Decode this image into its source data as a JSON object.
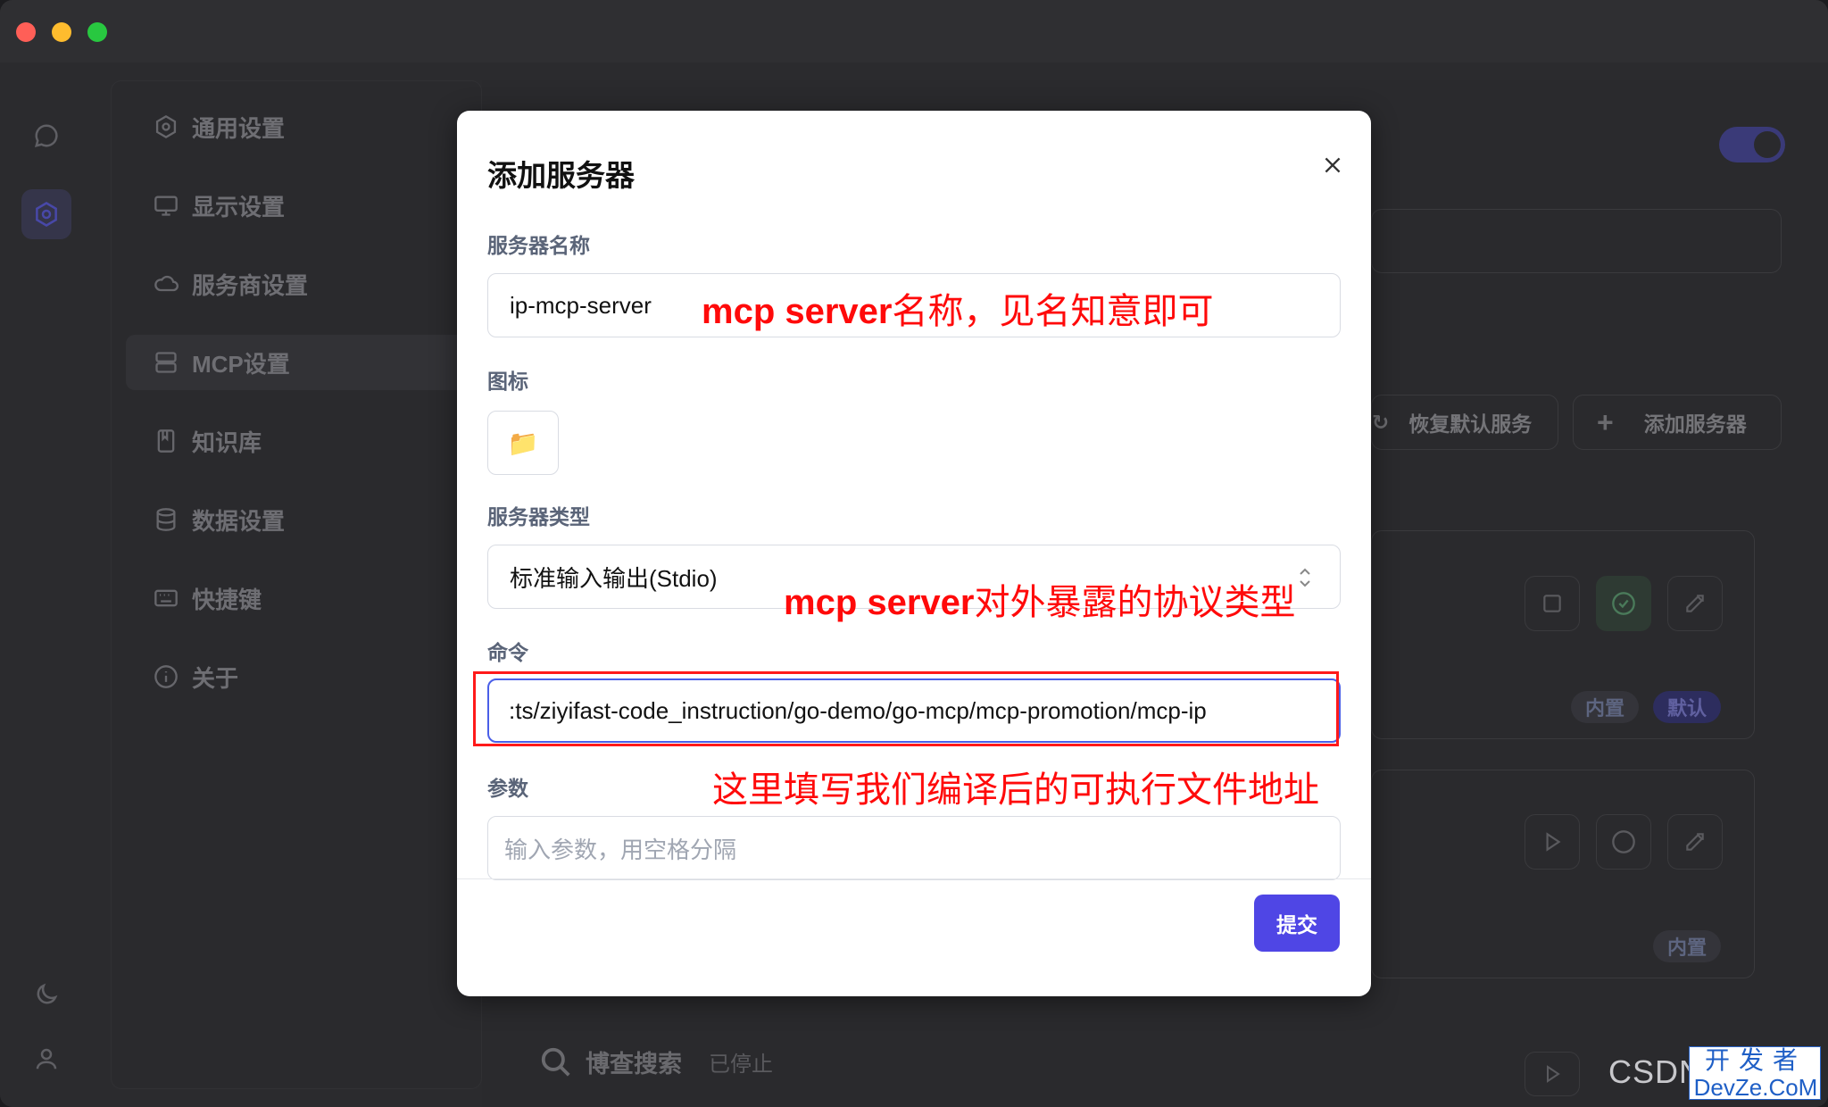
{
  "sidebar": {
    "items": [
      {
        "label": "通用设置",
        "icon": "gear-icon"
      },
      {
        "label": "显示设置",
        "icon": "monitor-icon"
      },
      {
        "label": "服务商设置",
        "icon": "cloud-icon"
      },
      {
        "label": "MCP设置",
        "icon": "server-icon"
      },
      {
        "label": "知识库",
        "icon": "book-icon"
      },
      {
        "label": "数据设置",
        "icon": "database-icon"
      },
      {
        "label": "快捷键",
        "icon": "keyboard-icon"
      },
      {
        "label": "关于",
        "icon": "info-icon"
      }
    ],
    "active_index": 3
  },
  "background": {
    "restore_label": "恢复默认服务",
    "add_server_label": "添加服务器",
    "badge_builtin": "内置",
    "badge_default": "默认",
    "badge_builtin_2": "内置",
    "bottom_server_name": "博查搜索",
    "bottom_server_status": "已停止"
  },
  "modal": {
    "title": "添加服务器",
    "name_label": "服务器名称",
    "name_value": "ip-mcp-server",
    "icon_label": "图标",
    "icon_glyph": "📁",
    "type_label": "服务器类型",
    "type_value": "标准输入输出(Stdio)",
    "command_label": "命令",
    "command_value": ":ts/ziyifast-code_instruction/go-demo/go-mcp/mcp-promotion/mcp-ip",
    "args_label": "参数",
    "args_placeholder": "输入参数，用空格分隔",
    "submit_label": "提交"
  },
  "annotations": {
    "name_note_bold": "mcp server",
    "name_note_rest": "名称，见名知意即可",
    "type_note_bold": "mcp server",
    "type_note_rest": "对外暴露的协议类型",
    "cmd_note": "这里填写我们编译后的可执行文件地址"
  },
  "watermark": {
    "csdn": "CSDN",
    "devze_top": "开发者",
    "devze_bottom": "DevZe.CoM"
  },
  "colors": {
    "accent": "#4f46e5",
    "annotation": "#ff0a0a",
    "toggle": "#3a3a78"
  }
}
